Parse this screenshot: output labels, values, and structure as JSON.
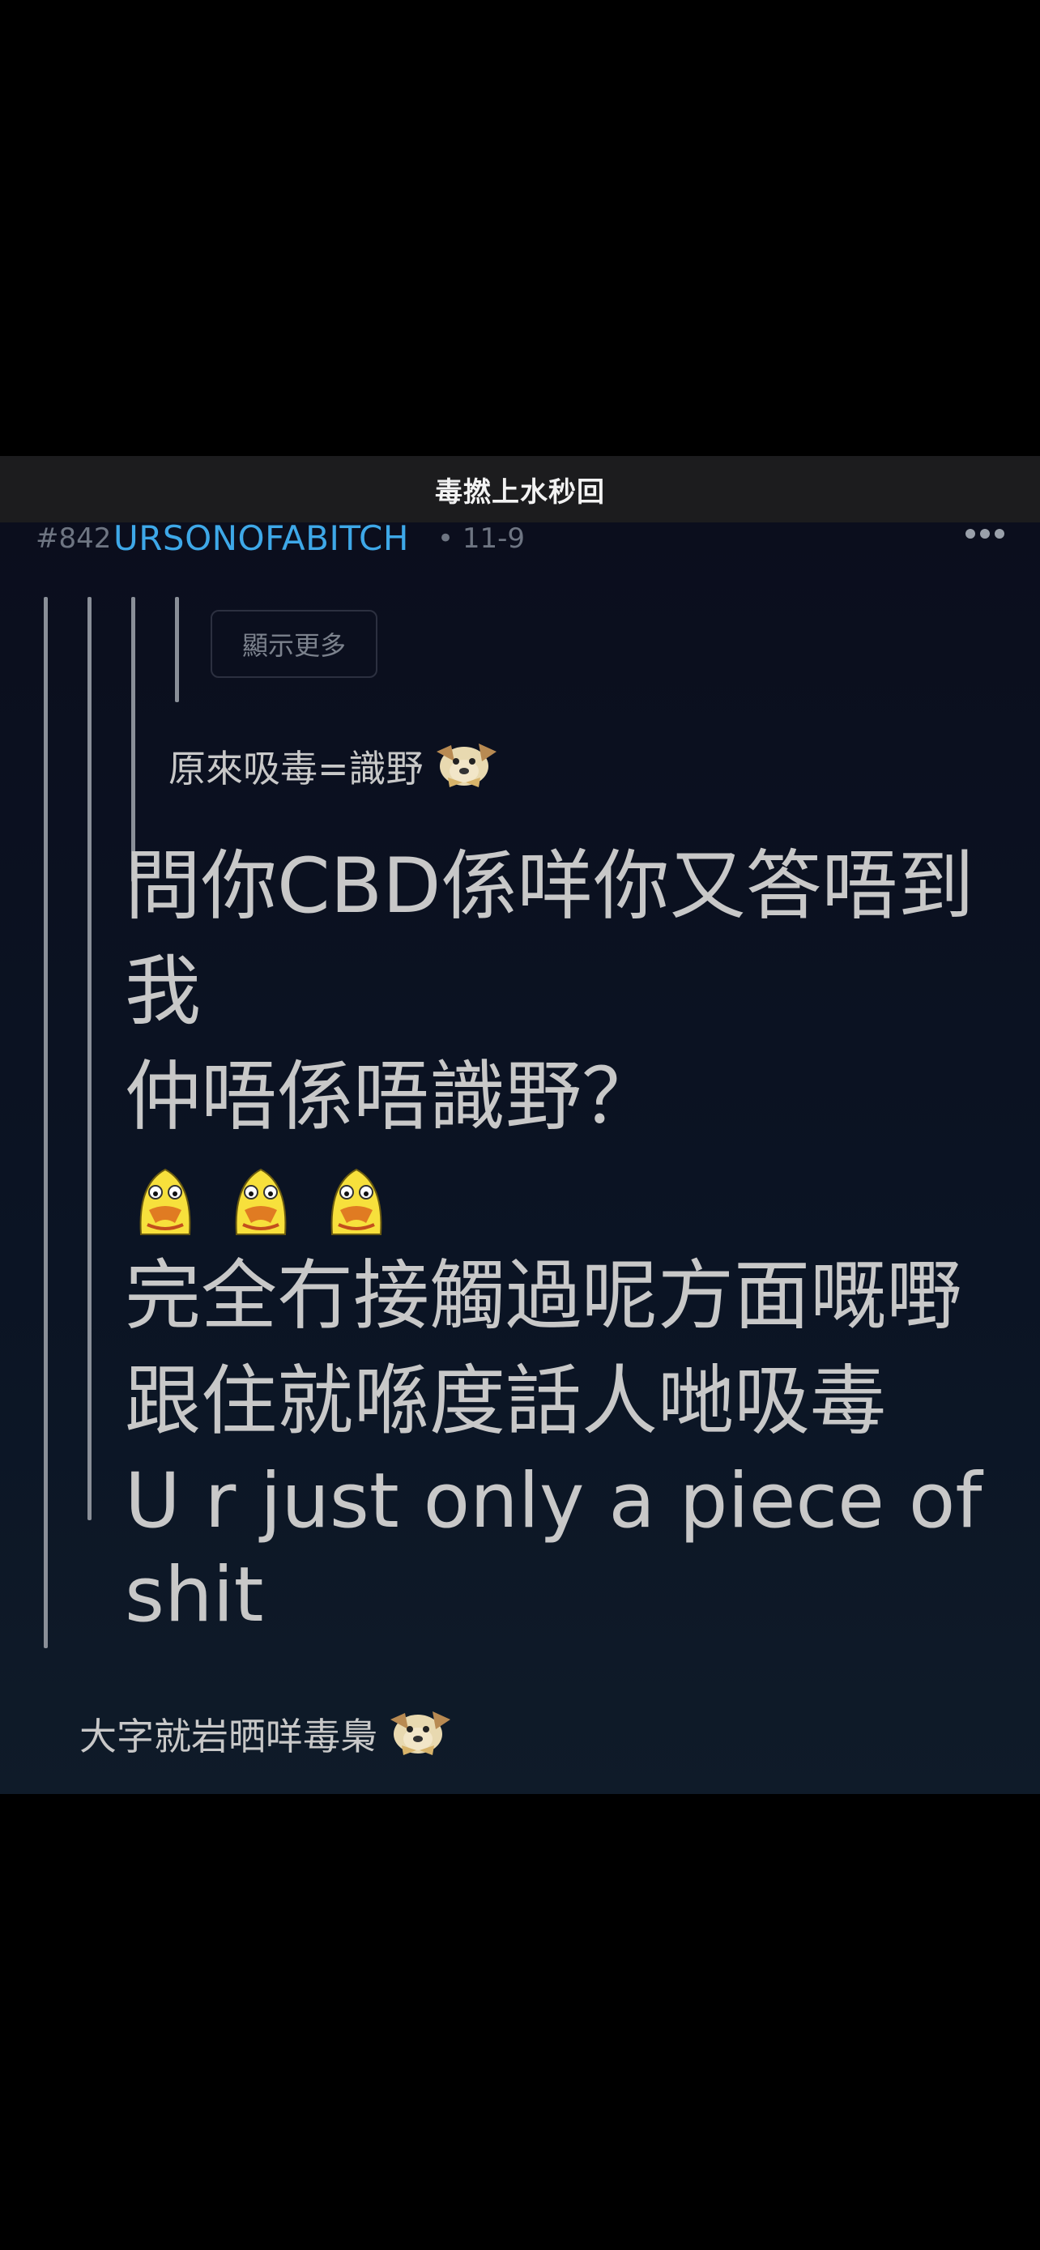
{
  "header": {
    "title": "毒撚上水秒回"
  },
  "post": {
    "number": "#842",
    "username": "URSONOFABITCH",
    "date": "• 11-9"
  },
  "quote": {
    "show_more_label": "顯示更多",
    "text": "原來吸毒=識野"
  },
  "reply": {
    "lines": [
      "問你CBD係咩你又答唔到",
      "我",
      "仲唔係唔識野？",
      "完全冇接觸過呢方面嘅嘢",
      "跟住就喺度話人哋吸毒",
      "U r just only a piece of",
      "shit"
    ],
    "emoji_count": 3
  },
  "comment": {
    "text": "大字就岩晒咩毒梟"
  },
  "icons": {
    "more": "more-dots-icon",
    "dog_emoji": "dog-face-emoji-icon",
    "chick_emoji": "yellow-chick-emoji-icon"
  },
  "colors": {
    "username": "#3ea8e8",
    "text": "#c8c8c8",
    "muted": "#6e7582",
    "background_top": "#0b0e1d",
    "background_bottom": "#0f1b29",
    "topbar": "#1c1c1e"
  }
}
